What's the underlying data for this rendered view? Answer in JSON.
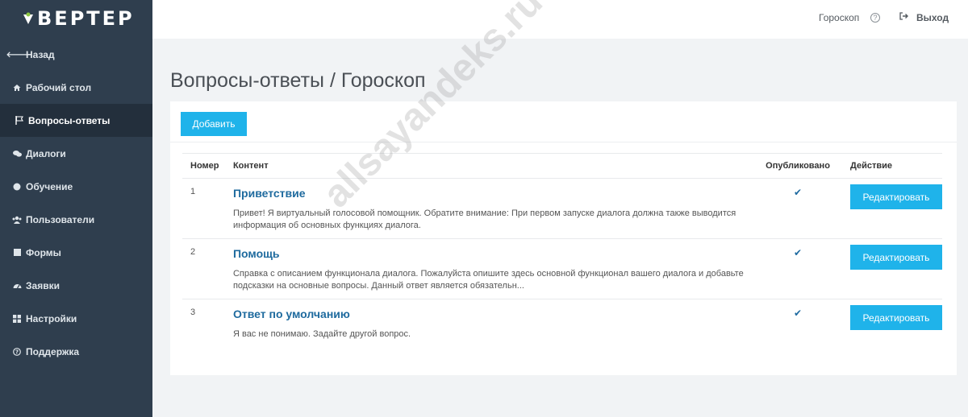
{
  "app": {
    "logo_text": "ВЕРТЕР"
  },
  "sidebar": {
    "items": [
      {
        "label": "Назад",
        "icon": "arrow-left-icon"
      },
      {
        "label": "Рабочий стол",
        "icon": "home-icon"
      },
      {
        "label": "Вопросы-ответы",
        "icon": "flag-icon",
        "active": true
      },
      {
        "label": "Диалоги",
        "icon": "comments-icon"
      },
      {
        "label": "Обучение",
        "icon": "circle-icon"
      },
      {
        "label": "Пользователи",
        "icon": "users-icon"
      },
      {
        "label": "Формы",
        "icon": "square-icon"
      },
      {
        "label": "Заявки",
        "icon": "dashboard-icon"
      },
      {
        "label": "Настройки",
        "icon": "grid-icon"
      },
      {
        "label": "Поддержка",
        "icon": "question-circle-icon"
      }
    ]
  },
  "topbar": {
    "skill_name": "Гороскоп",
    "help_icon": "?",
    "exit_label": "Выход"
  },
  "page": {
    "title": "Вопросы-ответы / Гороскоп"
  },
  "toolbar": {
    "add_label": "Добавить"
  },
  "table": {
    "headers": {
      "number": "Номер",
      "content": "Контент",
      "published": "Опубликовано",
      "action": "Действие"
    },
    "rows": [
      {
        "number": "1",
        "title": "Приветствие",
        "description": "Привет! Я виртуальный голосовой помощник. Обратите внимание: При первом запуске диалога должна также выводится информация об основных функциях диалога.",
        "published": "✔",
        "action": "Редактировать"
      },
      {
        "number": "2",
        "title": "Помощь",
        "description": "Справка с описанием функционала диалога. Пожалуйста опишите здесь основной функционал вашего диалога и добавьте подсказки на основные вопросы. Данный ответ является обязательн...",
        "published": "✔",
        "action": "Редактировать"
      },
      {
        "number": "3",
        "title": "Ответ по умолчанию",
        "description": "Я вас не понимаю. Задайте другой вопрос.",
        "published": "✔",
        "action": "Редактировать"
      }
    ]
  },
  "watermark": "allsayandeks.ru",
  "colors": {
    "sidebar": "#2f3e4e",
    "accent": "#1fb3ea",
    "link": "#1e6a9e"
  }
}
